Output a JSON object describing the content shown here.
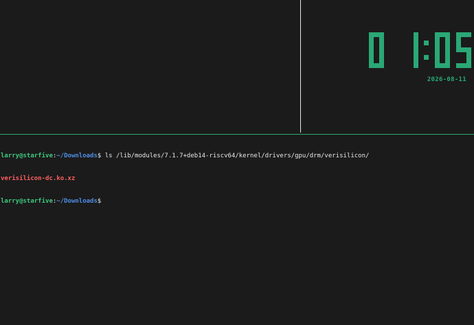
{
  "clock": {
    "digits": [
      "0",
      "1",
      "0",
      "5"
    ],
    "time_text": "01:05",
    "date": "2026-08-11",
    "color": "#2aa876"
  },
  "terminal": {
    "lines": [
      {
        "user_host": "larry@starfive",
        "separator": ":",
        "path": "~/Downloads",
        "prompt": "$",
        "command": " ls /lib/modules/7.1.7+deb14-riscv64/kernel/drivers/gpu/drm/verisilicon/"
      },
      {
        "output": "verisilicon-dc.ko.xz"
      },
      {
        "user_host": "larry@starfive",
        "separator": ":",
        "path": "~/Downloads",
        "prompt": "$",
        "command": ""
      }
    ]
  },
  "colors": {
    "background": "#1b1b1b",
    "user": "#3ec97e",
    "path": "#4f8fe6",
    "file_archive": "#ff5f5f",
    "divider_horizontal": "#2aa876",
    "divider_vertical": "#e8e8e8"
  }
}
